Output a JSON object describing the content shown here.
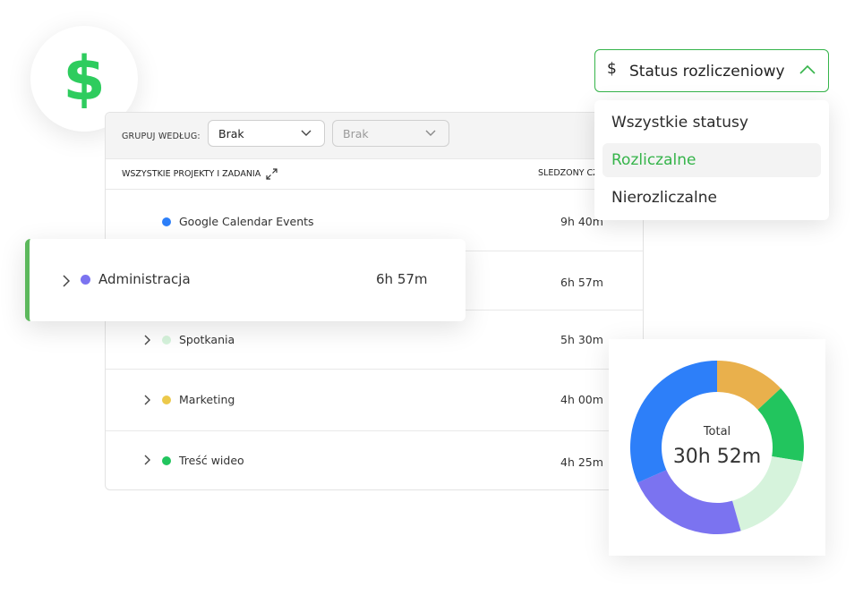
{
  "badge": {
    "icon": "dollar-icon",
    "color": "#2ecc5e"
  },
  "toolbar": {
    "group_label": "GRUPUJ WEDŁUG:",
    "group_primary": "Brak",
    "group_secondary": "Brak"
  },
  "table": {
    "header_left": "WSZYSTKIE PROJEKTY I ZADANIA",
    "header_right": "ŚLEDZONY CZAS",
    "rows": [
      {
        "name": "Google Calendar Events",
        "time": "9h 40m",
        "color": "#2d7ff9",
        "expandable": false
      },
      {
        "name": "Administracja",
        "time": "6h 57m",
        "color": "#7b73f0",
        "expandable": true
      },
      {
        "name": "Spotkania",
        "time": "5h 30m",
        "color": "#d6f3dc",
        "expandable": true
      },
      {
        "name": "Marketing",
        "time": "4h 00m",
        "color": "#ecc94b",
        "expandable": true
      },
      {
        "name": "Treść wideo",
        "time": "4h 25m",
        "color": "#22c55e",
        "expandable": true
      }
    ]
  },
  "highlight": {
    "name": "Administracja",
    "time": "6h 57m",
    "color": "#7b73f0",
    "accent": "#5cb85c"
  },
  "status_filter": {
    "label": "Status rozliczeniowy",
    "currency_symbol": "$",
    "accent": "#35b44a",
    "options": [
      "Wszystkie statusy",
      "Rozliczalne",
      "Nierozliczalne"
    ],
    "selected_index": 1
  },
  "chart_data": {
    "type": "pie",
    "total_label": "Total",
    "total_value": "30h 52m",
    "segments": [
      {
        "name": "Google Calendar Events",
        "minutes": 580,
        "color": "#2d7ff9"
      },
      {
        "name": "Administracja",
        "minutes": 417,
        "color": "#7b73f0"
      },
      {
        "name": "Spotkania",
        "minutes": 330,
        "color": "#d6f3dc"
      },
      {
        "name": "Marketing",
        "minutes": 240,
        "color": "#e9b04c"
      },
      {
        "name": "Treść wideo",
        "minutes": 265,
        "color": "#22c55e"
      }
    ]
  }
}
